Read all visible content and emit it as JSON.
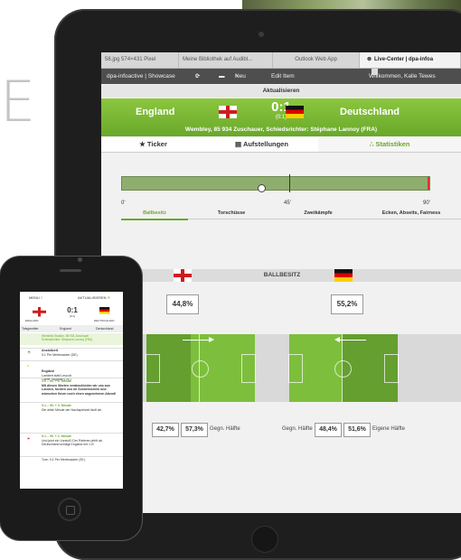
{
  "hero": {
    "letter": "E"
  },
  "tablet": {
    "browser_tabs": [
      {
        "label": "58.jpg 574×431 Pixel"
      },
      {
        "label": "Meine Bibliothek auf Audibl..."
      },
      {
        "label": "Outlook Web App"
      },
      {
        "label": "Live-Center | dpa-infoa"
      }
    ],
    "app_bar": {
      "site": "dpa-infoactive | Showcase",
      "refresh_count": "1",
      "new_label": "Neu",
      "edit_label": "Edit Item",
      "welcome": "Willkommen, Kalle Tewes"
    },
    "refresh_label": "Aktualisieren",
    "match": {
      "home": "England",
      "away": "Deutschland",
      "score": "0:1",
      "halftime": "(0:1)",
      "venue": "Wembley, 85 934 Zuschauer, Schiedsrichter: Stéphane Lannoy (FRA)"
    },
    "sub_tabs": [
      {
        "label": "★ Ticker"
      },
      {
        "label": "▤ Aufstellungen"
      },
      {
        "label": "∴ Statistiken"
      }
    ],
    "timeline": {
      "start": "0'",
      "mid": "45'",
      "end": "90'"
    },
    "stat_tabs": [
      {
        "label": "Ballbesitz"
      },
      {
        "label": "Torschüsse"
      },
      {
        "label": "Zweikämpfe"
      },
      {
        "label": "Ecken, Abseits, Fairness"
      }
    ],
    "possession": {
      "title": "BALLBESITZ",
      "home_pct": "44,8%",
      "away_pct": "55,2%",
      "home_pct_value": 44.8,
      "away_pct_value": 55.2
    },
    "halves": {
      "home_own": "42,7%",
      "home_opp": "57,3%",
      "opp_half_label": "Gegn. Hälfte",
      "away_opp": "48,4%",
      "away_own": "51,6%",
      "own_half_label": "Eigene Hälfte"
    }
  },
  "phone": {
    "menu": "MENU",
    "refresh": "AKTUALISIEREN",
    "score": "0:1",
    "halftime": "(0:1)",
    "home": "ENGLAND",
    "away": "DEUTSCHLAND",
    "tabs": [
      {
        "label": "Tatsgewitter"
      },
      {
        "label": "England"
      },
      {
        "label": "Deutschland"
      }
    ],
    "venue": "Wembley Stadion, 85 934 Zuschauer\nSchiedsrichter: Stephane Lannoy (FRA)",
    "events": [
      {
        "title": "Anstoßzeit",
        "text": "0:1 Per Mertesacker (DE)"
      },
      {
        "title": "England",
        "text": "Lambert statt Lescott\nCarter Vaughan (76.)"
      },
      {
        "title": "1:0 – 90. + 3. Minute",
        "text": "Mit diesen Worten verabschieden wir uns aus London, fordern uns im Sonnenschein und wünschen Ihnen noch einen angenehmen Abend!"
      },
      {
        "title": "0:1 – 90. + 3. Minute",
        "text": "Die dritte Minute der Nachspielzeit läuft ab."
      },
      {
        "title": "0:1 – 90. + 2. Minute",
        "text": "Und jetzt ein Vorstoß! Der Referee pfeift ab, Deutschland schlägt England mit 1:0!"
      },
      {
        "title": "Tore",
        "text": "Tore: 0:1 Per Mertesacker (39.)"
      }
    ]
  },
  "colors": {
    "green": "#69a82a",
    "bright_green": "#8cc63f",
    "red": "#d01c1f"
  }
}
